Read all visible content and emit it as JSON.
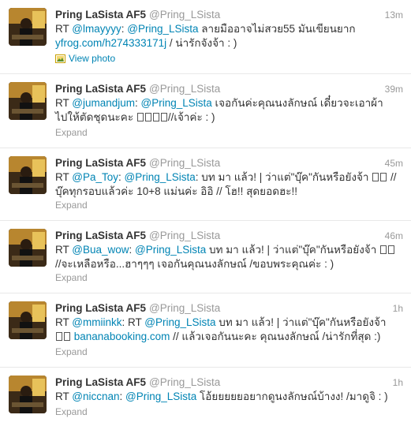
{
  "tweets": [
    {
      "name": "Pring LaSista AF5",
      "handle": "@Pring_LSista",
      "time": "13m",
      "rt": "RT",
      "line1": {
        "m1": "@lmayyyy",
        "sep": ": ",
        "m2": "@Pring_LSista",
        "rest": " ลายมืออาจไม่สวย55 มันเขียนยาก"
      },
      "line2": {
        "link": "yfrog.com/h274333171j",
        "rest": " / น่ารักจังจ้า : )"
      },
      "footer": "View photo"
    },
    {
      "name": "Pring LaSista AF5",
      "handle": "@Pring_LSista",
      "time": "39m",
      "rt": "RT",
      "line1": {
        "m1": "@jumandjum",
        "sep": ": ",
        "m2": "@Pring_LSista",
        "rest": " เจอกันค่ะคุณนงลักษณ์ เดี๋ยวจะเอาผ้า"
      },
      "line2": {
        "pre": "ไปให้ตัดชุดนะคะ ",
        "post": "//เจ้าค่ะ : )"
      },
      "footer": "Expand"
    },
    {
      "name": "Pring LaSista AF5",
      "handle": "@Pring_LSista",
      "time": "45m",
      "rt": "RT",
      "line1": {
        "m1": "@Pa_Toy",
        "sep": ": ",
        "m2": "@Pring_LSista",
        "rest": ": บท มา แล้ว! | ว่าแต่\"บุ๊ค\"กันหรือยังจ้า ",
        "post": " //"
      },
      "line2": {
        "text": "บุ๊คทุกรอบแล้วค่ะ 10+8 แม่นค่ะ อิอิ // โฮ!! สุดยอดฮะ!!"
      },
      "footer": "Expand"
    },
    {
      "name": "Pring LaSista AF5",
      "handle": "@Pring_LSista",
      "time": "46m",
      "rt": "RT",
      "line1": {
        "m1": "@Bua_wow",
        "sep": ": ",
        "m2": "@Pring_LSista",
        "rest": " บท มา แล้ว! | ว่าแต่\"บุ๊ค\"กันหรือยังจ้า "
      },
      "line2": {
        "text": "//จะเหลือหรือ...ฮาๆๆๆ เจอกันคุณนงลักษณ์ /ขอบพระคุณค่ะ : )"
      },
      "footer": "Expand"
    },
    {
      "name": "Pring LaSista AF5",
      "handle": "@Pring_LSista",
      "time": "1h",
      "rt": "RT",
      "line1": {
        "m1": "@mmiinkk",
        "sep": ": RT ",
        "m2": "@Pring_LSista",
        "rest": " บท มา แล้ว! | ว่าแต่\"บุ๊ค\"กันหรือยังจ้า"
      },
      "line2": {
        "link": "bananabooking.com",
        "rest": " // แล้วเจอกันนะคะ คุณนงลักษณ์ /น่ารักที่สุด :)"
      },
      "footer": "Expand"
    },
    {
      "name": "Pring LaSista AF5",
      "handle": "@Pring_LSista",
      "time": "1h",
      "rt": "RT",
      "line1": {
        "m1": "@niccnan",
        "sep": ": ",
        "m2": "@Pring_LSista",
        "rest": " โอ้ยยยยยอยากดูนงลักษณ์บ้างง! /มาดูจิ : )"
      },
      "footer": "Expand"
    }
  ],
  "icons": {
    "photo": "photo-icon",
    "avatar": "profile-avatar"
  },
  "colors": {
    "link": "#0084b4",
    "muted": "#999999",
    "text": "#333333"
  }
}
